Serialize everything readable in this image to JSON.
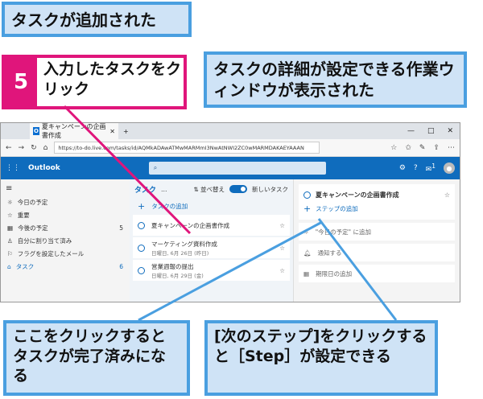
{
  "callouts": {
    "added": "タスクが追加された",
    "detail": "タスクの詳細が設定できる作業ウィンドウが表示された",
    "complete": "ここをクリックするとタスクが完了済みになる",
    "step": "[次のステップ]をクリックすると［Step］が設定できる"
  },
  "step_marker": {
    "number": "5",
    "text": "入力したタスクをクリック"
  },
  "browser": {
    "tab_title": "夏キャンペーンの企画書作成",
    "url": "https://to-do.live.com/tasks/id/AQMkADAwATMwMARMmI3NwAtNWI2ZC0wMARMDAKAEYAAAN",
    "window_controls": [
      "—",
      "□",
      "✕"
    ]
  },
  "outlook": {
    "app_name": "Outlook",
    "notification_count": "1"
  },
  "sidebar": {
    "items": [
      {
        "icon": "☼",
        "label": "今日の予定",
        "count": ""
      },
      {
        "icon": "☆",
        "label": "重要",
        "count": ""
      },
      {
        "icon": "▦",
        "label": "今後の予定",
        "count": "5"
      },
      {
        "icon": "♙",
        "label": "自分に割り当て済み",
        "count": ""
      },
      {
        "icon": "⚐",
        "label": "フラグを設定したメール",
        "count": ""
      },
      {
        "icon": "⌂",
        "label": "タスク",
        "count": "6"
      }
    ]
  },
  "main": {
    "title": "タスク",
    "more": "…",
    "sort_label": "並べ替え",
    "new_list_label": "新しいタスク",
    "add_task_label": "タスクの追加",
    "tasks": [
      {
        "name": "夏キャンペーンの企画書作成",
        "date": ""
      },
      {
        "name": "マーケティング資料作成",
        "date": "日曜日, 6月 26日 (昨日)"
      },
      {
        "name": "営業週報の提出",
        "date": "日曜日, 6月 29日 (金)"
      }
    ]
  },
  "detail": {
    "title": "夏キャンペーンの企画書作成",
    "add_step": "ステップの追加",
    "my_day": "\"今日の予定\" に追加",
    "remind": "通知する",
    "due": "期限日の追加"
  },
  "colors": {
    "callout_border": "#4a9fe0",
    "step_accent": "#e0157b",
    "outlook_blue": "#0f6cbd"
  }
}
